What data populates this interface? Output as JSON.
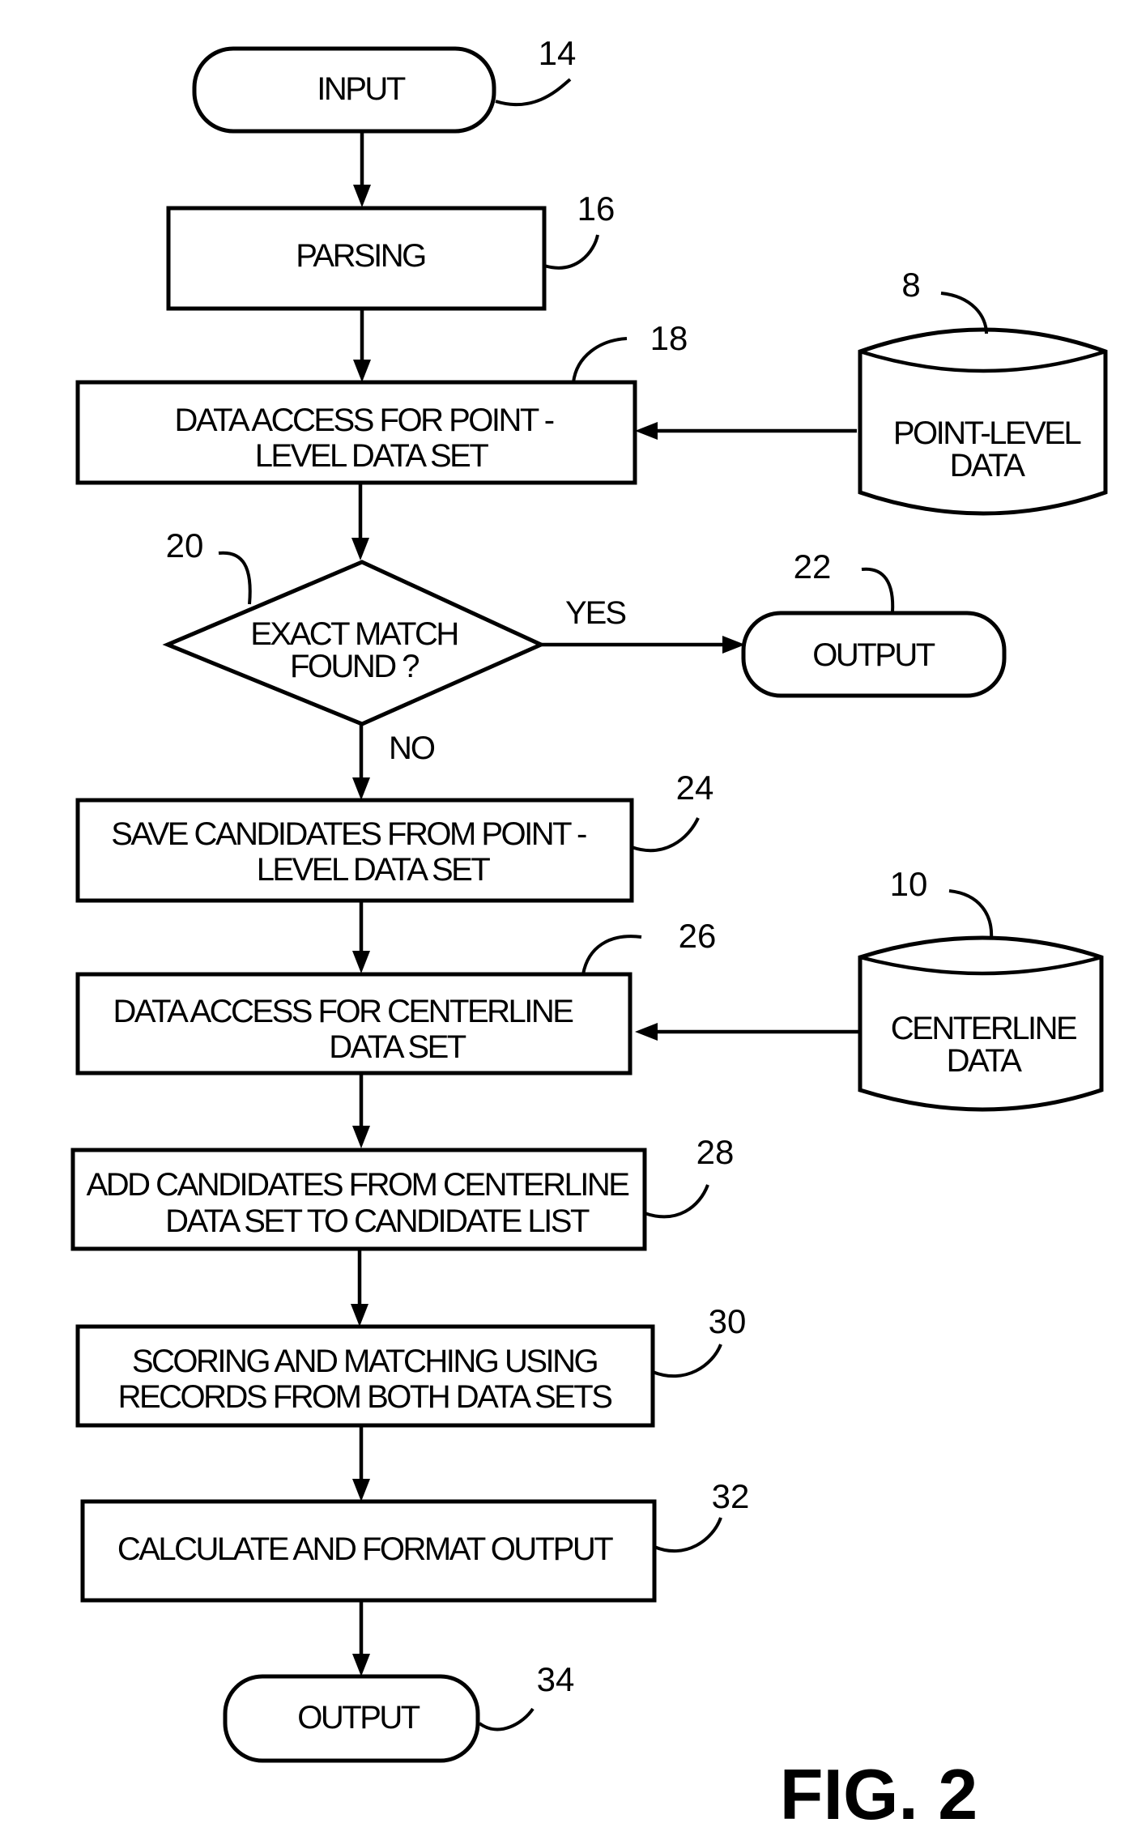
{
  "diagram": {
    "figure_label": "FIG. 2",
    "type": "flowchart",
    "nodes": {
      "input": {
        "ref": "14",
        "shape": "terminal",
        "lines": [
          "INPUT"
        ]
      },
      "parsing": {
        "ref": "16",
        "shape": "process",
        "lines": [
          "PARSING"
        ]
      },
      "data_access_point": {
        "ref": "18",
        "shape": "process",
        "lines": [
          "DATA ACCESS FOR POINT -",
          "LEVEL  DATA SET"
        ]
      },
      "point_level_db": {
        "ref": "8",
        "shape": "database",
        "lines": [
          "POINT-LEVEL",
          "DATA"
        ]
      },
      "exact_match": {
        "ref": "20",
        "shape": "decision",
        "lines": [
          "EXACT MATCH",
          "FOUND ?"
        ]
      },
      "output_early": {
        "ref": "22",
        "shape": "terminal",
        "lines": [
          "OUTPUT"
        ]
      },
      "save_candidates": {
        "ref": "24",
        "shape": "process",
        "lines": [
          "SAVE CANDIDATES FROM POINT -",
          "LEVEL DATA SET"
        ]
      },
      "data_access_centerline": {
        "ref": "26",
        "shape": "process",
        "lines": [
          "DATA ACCESS FOR CENTERLINE",
          "DATA SET"
        ]
      },
      "centerline_db": {
        "ref": "10",
        "shape": "database",
        "lines": [
          "CENTERLINE",
          "DATA"
        ]
      },
      "add_candidates": {
        "ref": "28",
        "shape": "process",
        "lines": [
          "ADD CANDIDATES FROM CENTERLINE",
          "DATA SET TO CANDIDATE LIST"
        ]
      },
      "scoring_matching": {
        "ref": "30",
        "shape": "process",
        "lines": [
          "SCORING AND MATCHING USING",
          "RECORDS FROM BOTH DATA SETS"
        ]
      },
      "calc_format": {
        "ref": "32",
        "shape": "process",
        "lines": [
          "CALCULATE AND FORMAT OUTPUT"
        ]
      },
      "output_final": {
        "ref": "34",
        "shape": "terminal",
        "lines": [
          "OUTPUT"
        ]
      }
    },
    "edges": [
      {
        "from": "input",
        "to": "parsing",
        "label": ""
      },
      {
        "from": "parsing",
        "to": "data_access_point",
        "label": ""
      },
      {
        "from": "point_level_db",
        "to": "data_access_point",
        "label": ""
      },
      {
        "from": "data_access_point",
        "to": "exact_match",
        "label": ""
      },
      {
        "from": "exact_match",
        "to": "output_early",
        "label": "YES"
      },
      {
        "from": "exact_match",
        "to": "save_candidates",
        "label": "NO"
      },
      {
        "from": "save_candidates",
        "to": "data_access_centerline",
        "label": ""
      },
      {
        "from": "centerline_db",
        "to": "data_access_centerline",
        "label": ""
      },
      {
        "from": "data_access_centerline",
        "to": "add_candidates",
        "label": ""
      },
      {
        "from": "add_candidates",
        "to": "scoring_matching",
        "label": ""
      },
      {
        "from": "scoring_matching",
        "to": "calc_format",
        "label": ""
      },
      {
        "from": "calc_format",
        "to": "output_final",
        "label": ""
      }
    ]
  }
}
